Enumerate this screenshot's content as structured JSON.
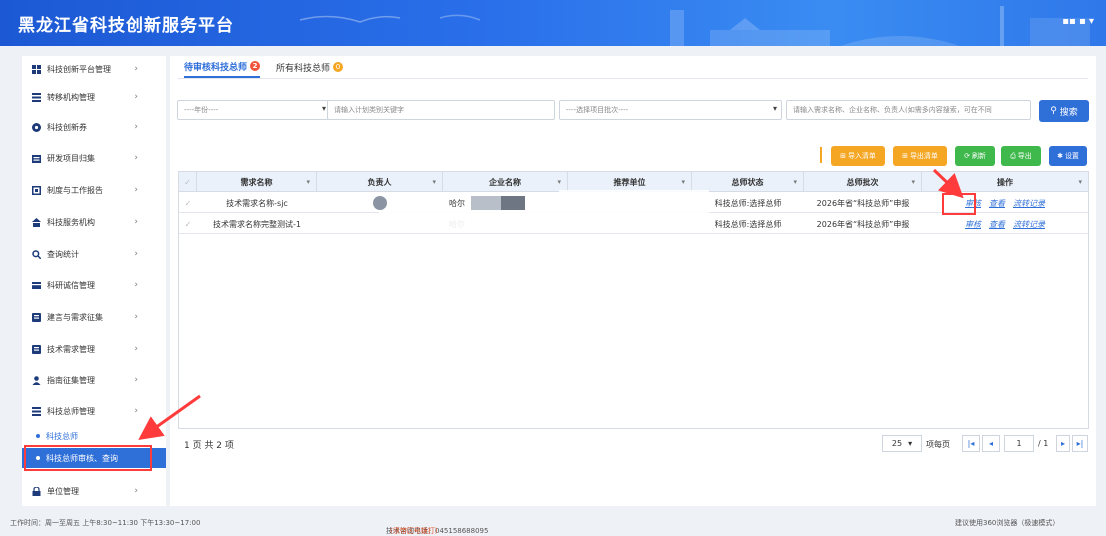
{
  "header": {
    "title": "黑龙江省科技创新服务平台",
    "window_controls": "▪▪ ▪ ▾"
  },
  "sidebar": {
    "items": [
      {
        "label": "科技创新平台管理",
        "icon": "grid-icon"
      },
      {
        "label": "转移机构管理",
        "icon": "list-icon"
      },
      {
        "label": "科技创新券",
        "icon": "ticket-icon"
      },
      {
        "label": "研发项目归集",
        "icon": "folder-icon"
      },
      {
        "label": "制度与工作报告",
        "icon": "report-icon"
      },
      {
        "label": "科技服务机构",
        "icon": "org-icon"
      },
      {
        "label": "查询统计",
        "icon": "search-icon"
      },
      {
        "label": "科研诚信管理",
        "icon": "card-icon"
      },
      {
        "label": "建言与需求征集",
        "icon": "chat-icon"
      },
      {
        "label": "技术需求管理",
        "icon": "doc-icon"
      },
      {
        "label": "指南征集管理",
        "icon": "user-icon"
      },
      {
        "label": "科技总师管理",
        "icon": "list-icon"
      }
    ],
    "sub_items": [
      {
        "label": "科技总师"
      },
      {
        "label": "科技总师审核、查询"
      }
    ],
    "last_item": {
      "label": "单位管理",
      "icon": "lock-icon"
    },
    "chevron": "›"
  },
  "tabs": [
    {
      "label": "待审核科技总师",
      "badge": "2",
      "badge_color": "#f0533a"
    },
    {
      "label": "所有科技总师",
      "badge": "0",
      "badge_color": "#f5a623"
    }
  ],
  "filters": {
    "year": "----年份----",
    "keyword_placeholder": "请输入计划类别关键字",
    "batch": "----选择项目批次----",
    "search_placeholder": "请输入需求名称、企业名称、负责人(如需多内容搜索，可在不同",
    "search_button": "搜索"
  },
  "toolbar": {
    "import": "导入清单",
    "export_list": "导出清单",
    "refresh": "刷新",
    "export": "导出",
    "settings": "设置"
  },
  "table": {
    "columns": [
      "需求名称",
      "负责人",
      "企业名称",
      "推荐单位",
      "总师状态",
      "总师批次",
      "操作"
    ],
    "rows": [
      {
        "name": "技术需求名称-sjc",
        "person": "",
        "company": "哈尔",
        "unit": "",
        "status": "科技总师:选择总师",
        "batch": "2026年省“科技总师”申报"
      },
      {
        "name": "技术需求名称完整测试-1",
        "person": "",
        "company": "哈尔",
        "unit": "",
        "status": "科技总师:选择总师",
        "batch": "2026年省“科技总师”申报"
      }
    ],
    "actions": [
      "审核",
      "查看",
      "流转记录"
    ]
  },
  "pager": {
    "info": "1 页 共 2 项",
    "page_size": "25",
    "per_page_label": "项每页",
    "page": "1",
    "total_pages": "/ 1"
  },
  "footer": {
    "hours": "工作时间：周一至周五 上午8:30~11:30 下午13:30~17:00",
    "phone": "技术咨询电话：045158688095",
    "phone_note": "(须带区号拨打)",
    "browser": "建议使用360浏览器（极速模式）"
  },
  "colors": {
    "primary": "#2f6fd8",
    "orange": "#f5a623",
    "green": "#3fb84c",
    "red": "#ff3b3b"
  }
}
